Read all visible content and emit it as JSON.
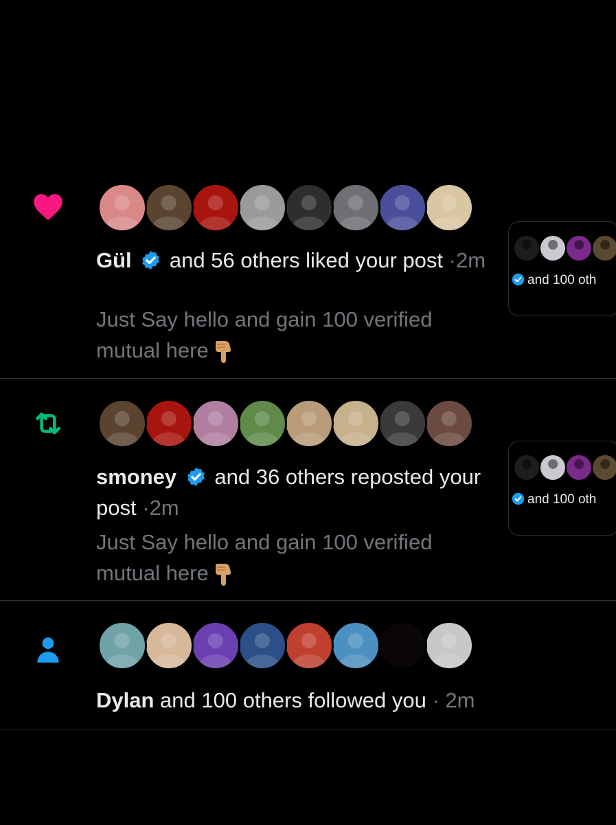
{
  "notifications": [
    {
      "type_icon": "heart-icon",
      "icon_color": "#f91880",
      "avatar_colors": [
        "#d98a88",
        "#5a4430",
        "#a8140e",
        "#9a9a9a",
        "#2e2e2e",
        "#6f6f74",
        "#4b4f9a",
        "#d9c6a2"
      ],
      "actor_name": "Gül",
      "verified": true,
      "action_text": "and 56 others liked your post",
      "separator": "·",
      "time": "2m",
      "post_text": "Just Say hello and gain 100 verified mutual here",
      "post_emoji": "backhand-index-pointing-down-icon",
      "preview": {
        "avatar_colors": [
          "#1d1d1d",
          "#c9c9cf",
          "#7a2a8a",
          "#5a4a30"
        ],
        "text": "and 100 oth"
      }
    },
    {
      "type_icon": "repost-icon",
      "icon_color": "#00ba7c",
      "avatar_colors": [
        "#5a4430",
        "#a8140e",
        "#b07ea0",
        "#5f8a4a",
        "#b89b78",
        "#c7b08c",
        "#3a3a3a",
        "#6b4a40"
      ],
      "actor_name": "smoney",
      "verified": true,
      "action_text": "and 36 others reposted your post",
      "separator": "·",
      "time": "2m",
      "post_text": "Just Say hello and gain 100 verified mutual here",
      "post_emoji": "backhand-index-pointing-down-icon",
      "preview": {
        "avatar_colors": [
          "#1d1d1d",
          "#c9c9cf",
          "#7a2a8a",
          "#5a4a30"
        ],
        "text": "and 100 oth"
      }
    },
    {
      "type_icon": "person-icon",
      "icon_color": "#1d9bf0",
      "avatar_colors": [
        "#6fa3a8",
        "#d8b89a",
        "#6a3fb0",
        "#2c4f88",
        "#c04030",
        "#4a90c0",
        "#0a0608",
        "#c8c8c8"
      ],
      "actor_name": "Dylan",
      "verified": false,
      "action_text": "and 100 others followed you",
      "separator": "·",
      "time": "2m"
    }
  ],
  "colors": {
    "background": "#000000",
    "text": "#e7e9ea",
    "secondary_text": "#71767b",
    "divider": "#2f3336",
    "verified_badge": "#1d9bf0"
  }
}
